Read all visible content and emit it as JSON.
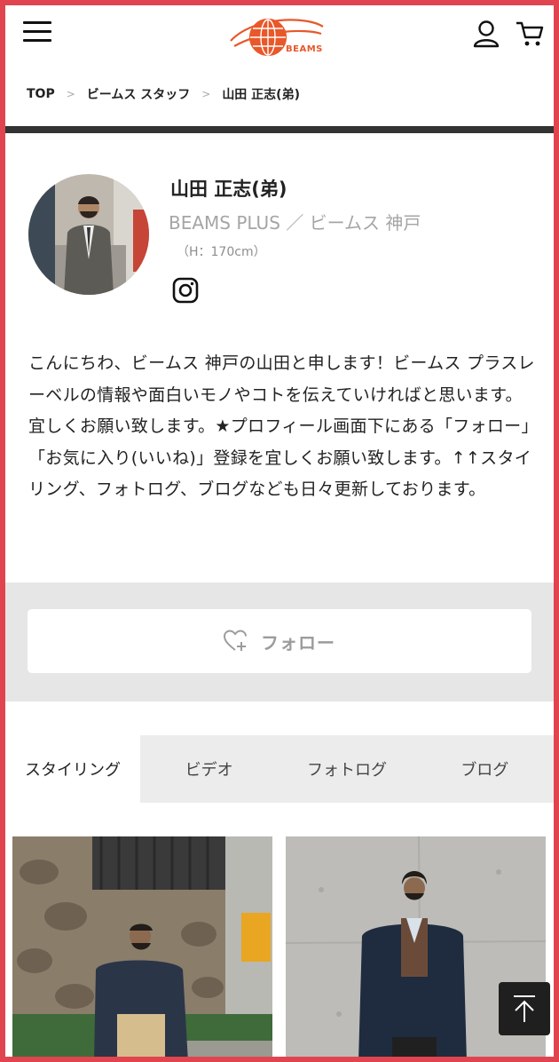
{
  "header": {
    "menu_icon": "hamburger-menu-icon",
    "logo_text": "BEAMS",
    "user_icon": "user-icon",
    "cart_icon": "cart-icon",
    "brand_color": "#e8582a"
  },
  "breadcrumb": [
    "TOP",
    "ビームス スタッフ",
    "山田 正志(弟)"
  ],
  "breadcrumb_separator": ">",
  "profile": {
    "name": "山田 正志(弟)",
    "store": "BEAMS PLUS ／ ビームス 神戸",
    "height": "（H：170cm）",
    "instagram_icon": "instagram-icon",
    "bio": "こんにちわ、ビームス 神戸の山田と申します！ビームス プラスレーベルの情報や面白いモノやコトを伝えていければと思います。宜しくお願い致します。★プロフィール画面下にある「フォロー」「お気に入り(いいね)」登録を宜しくお願い致します。↑↑スタイリング、フォトログ、ブログなども日々更新しております。"
  },
  "follow": {
    "label": "フォロー",
    "icon": "heart-plus-icon"
  },
  "tabs": [
    {
      "label": "スタイリング",
      "active": true
    },
    {
      "label": "ビデオ",
      "active": false
    },
    {
      "label": "フォトログ",
      "active": false
    },
    {
      "label": "ブログ",
      "active": false
    }
  ],
  "scroll_top_icon": "arrow-up-icon",
  "frame_color": "#e0454f"
}
